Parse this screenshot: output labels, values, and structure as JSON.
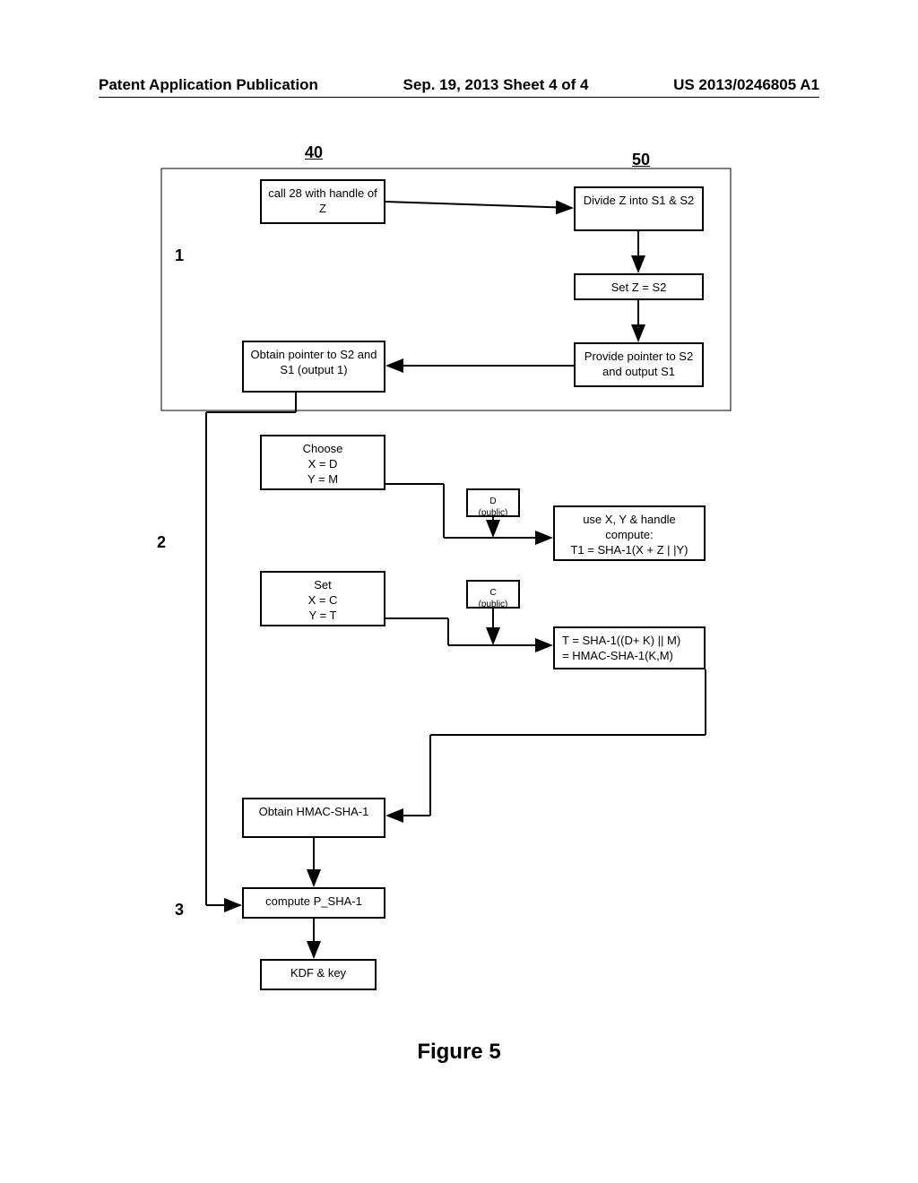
{
  "header": {
    "left": "Patent Application Publication",
    "center": "Sep. 19, 2013  Sheet 4 of 4",
    "right": "US 2013/0246805 A1"
  },
  "references": {
    "ref40": "40",
    "ref50": "50"
  },
  "steps": {
    "step1": "1",
    "step2": "2",
    "step3": "3"
  },
  "boxes": {
    "call": "call 28 with handle of Z",
    "divide": "Divide Z into S1 & S2",
    "setz": "Set Z = S2",
    "obtain_pointer": "Obtain pointer to S2 and S1 (output 1)",
    "provide_pointer": "Provide pointer to S2 and output S1",
    "choose": "Choose\nX = D\nY = M",
    "d_public": "D\n(public)",
    "use_xy": "use X, Y & handle compute:\nT1 = SHA-1(X + Z | |Y)",
    "set_xct": "Set\nX = C\nY = T",
    "c_public": "C\n(public)",
    "t_sha": "T = SHA-1((D+ K) || M)\n= HMAC-SHA-1(K,M)",
    "obtain_hmac": "Obtain HMAC-SHA-1",
    "compute_psha": "compute P_SHA-1",
    "kdf": "KDF & key"
  },
  "figure_label": "Figure 5"
}
